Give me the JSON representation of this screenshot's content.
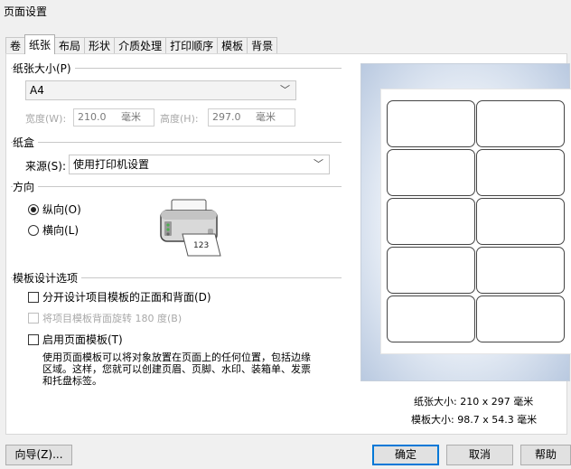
{
  "window": {
    "title": "页面设置"
  },
  "tabs": [
    "卷",
    "纸张",
    "布局",
    "形状",
    "介质处理",
    "打印顺序",
    "模板",
    "背景"
  ],
  "paper_size": {
    "group_label": "纸张大小(P)",
    "selected": "A4",
    "width_label": "宽度(W):",
    "width_value": "210.0",
    "width_unit": "毫米",
    "height_label": "高度(H):",
    "height_value": "297.0",
    "height_unit": "毫米"
  },
  "paper_tray": {
    "group_label": "纸盒",
    "source_label": "来源(S):",
    "source_value": "使用打印机设置"
  },
  "orientation": {
    "group_label": "方向",
    "portrait": "纵向(O)",
    "landscape": "横向(L)",
    "selected": "portrait"
  },
  "template_design": {
    "group_label": "模板设计选项",
    "option1": "分开设计项目模板的正面和背面(D)",
    "option2": "将项目模板背面旋转 180 度(B)",
    "option3": "启用页面模板(T)",
    "description_line1": "使用页面模板可以将对象放置在页面上的任何位置，包括边缘",
    "description_line2": "区域。这样，您就可以创建页眉、页脚、水印、装箱单、发票",
    "description_line3": "和托盘标签。"
  },
  "preview": {
    "paper_size_text": "纸张大小: 210 x 297 毫米",
    "template_size_text": "模板大小: 98.7 x 54.3 毫米",
    "printer_paper_text": "123"
  },
  "buttons": {
    "wizard": "向导(Z)...",
    "ok": "确定",
    "cancel": "取消",
    "help": "帮助"
  },
  "colors": {
    "accent": "#0078d7",
    "dialog_bg": "#f0f0f0",
    "panel_bg": "#ffffff"
  },
  "icons": {
    "dropdown": "chevron-down-icon",
    "printer": "printer-icon"
  }
}
